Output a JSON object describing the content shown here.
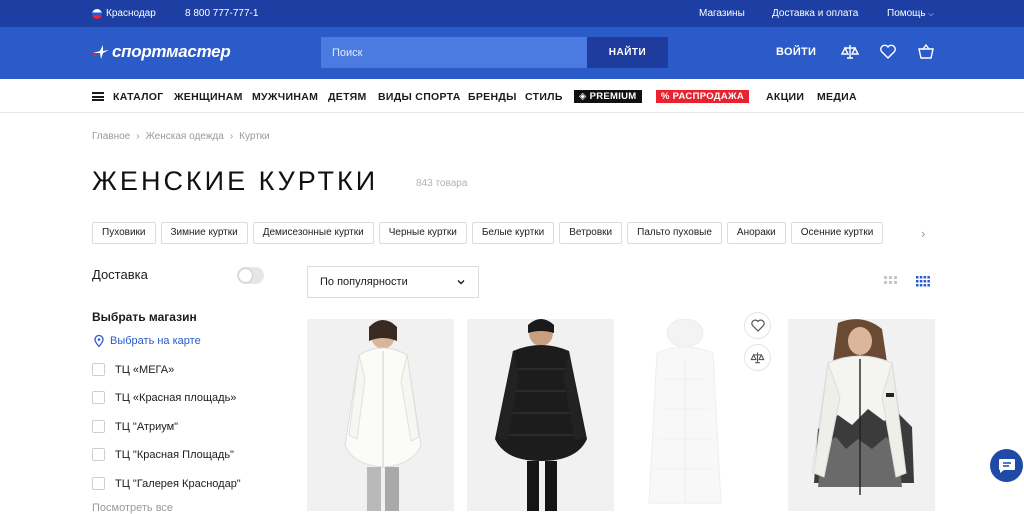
{
  "topbar": {
    "region": "Краснодар",
    "phone": "8 800 777-777-1",
    "links": [
      "Магазины",
      "Доставка и оплата",
      "Помощь"
    ]
  },
  "header": {
    "logo": "спортмастер",
    "search_placeholder": "Поиск",
    "search_button": "НАЙТИ",
    "login": "ВОЙТИ"
  },
  "nav": {
    "catalog": "КАТАЛОГ",
    "items": [
      "ЖЕНЩИНАМ",
      "МУЖЧИНАМ",
      "ДЕТЯМ",
      "ВИДЫ СПОРТА",
      "БРЕНДЫ",
      "СТИЛЬ"
    ],
    "premium": "PREMIUM",
    "sale": "% РАСПРОДАЖА",
    "extra": [
      "АКЦИИ",
      "МЕДИА"
    ]
  },
  "breadcrumb": [
    "Главное",
    "Женская одежда",
    "Куртки"
  ],
  "page": {
    "title": "ЖЕНСКИЕ КУРТКИ",
    "count": "843 товара"
  },
  "chips": [
    "Пуховики",
    "Зимние куртки",
    "Демисезонные куртки",
    "Черные куртки",
    "Белые куртки",
    "Ветровки",
    "Пальто пуховые",
    "Анораки",
    "Осенние куртки"
  ],
  "filters": {
    "delivery": "Доставка",
    "store_title": "Выбрать магазин",
    "map_link": "Выбрать на карте",
    "stores": [
      "ТЦ «МЕГА»",
      "ТЦ «Красная площадь»",
      "ТЦ \"Атриум\"",
      "ТЦ \"Красная Площадь\"",
      "ТЦ \"Галерея Краснодар\""
    ],
    "show_all": "Посмотреть все"
  },
  "sort": {
    "value": "По популярности"
  },
  "colors": {
    "topbar": "#1d3fa3",
    "header": "#2b5ac9",
    "sale": "#e8222f"
  }
}
